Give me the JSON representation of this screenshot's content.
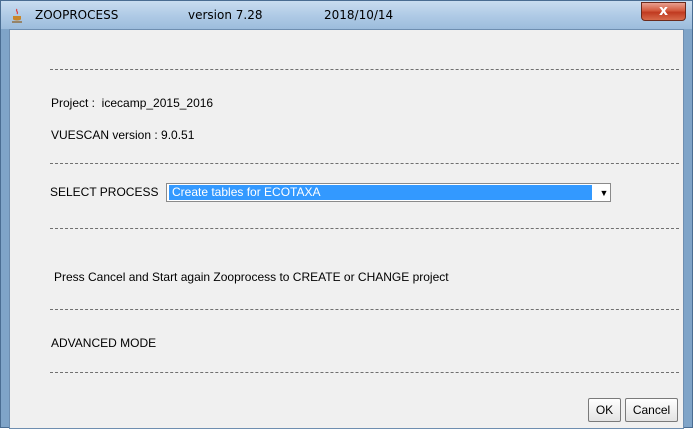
{
  "window": {
    "app_name": "ZOOPROCESS",
    "version": "version 7.28",
    "date": "2018/10/14",
    "close_glyph": "x",
    "accent_color": "#7fa4c8"
  },
  "info": {
    "project": "Project :  icecamp_2015_2016",
    "vuescan": "VUESCAN version : 9.0.51"
  },
  "process": {
    "label": "SELECT PROCESS",
    "selected": "Create tables for ECOTAXA",
    "highlight_color": "#3399ff"
  },
  "message": "Press Cancel and Start again Zooprocess to CREATE or CHANGE project",
  "advanced_label": "ADVANCED MODE",
  "buttons": {
    "ok": "OK",
    "cancel": "Cancel"
  }
}
